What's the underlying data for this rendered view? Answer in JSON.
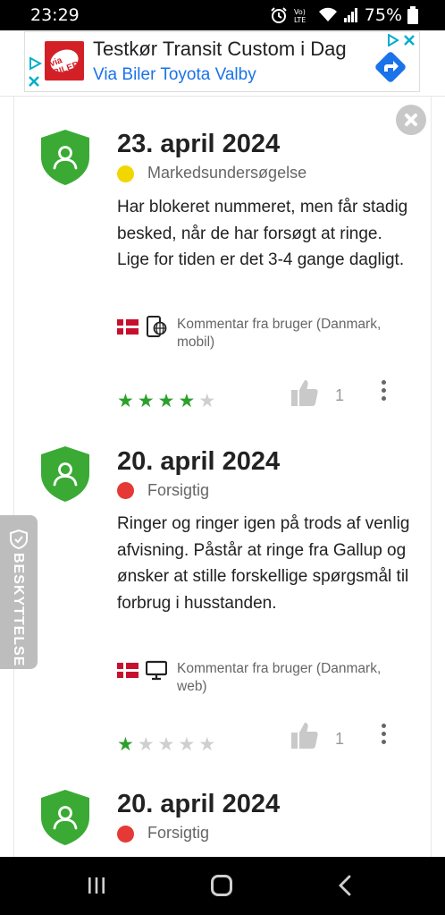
{
  "status_bar": {
    "time": "23:29",
    "network": "Vo) LTE",
    "battery": "75%"
  },
  "ad": {
    "logo_text": "via BILER",
    "title": "Testkør Transit Custom i Dag",
    "subtitle": "Via Biler Toyota Valby"
  },
  "side_tab": {
    "label": "BESKYTTELSE"
  },
  "reviews": [
    {
      "date": "23. april 2024",
      "category": "Markedsundersøgelse",
      "category_color": "#f2d600",
      "text": "Har blokeret nummeret, men får stadig besked, når de har forsøgt at ringe. Lige for tiden er det 3-4 gange dagligt.",
      "device": "mobile-globe-icon",
      "source": "Kommentar fra bruger (Danmark, mobil)",
      "rating": 4,
      "likes": "1"
    },
    {
      "date": "20. april 2024",
      "category": "Forsigtig",
      "category_color": "#e53935",
      "text": "Ringer og ringer igen på trods af venlig afvisning. Påstår at ringe fra Gallup og ønsker at stille forskellige spørgsmål til forbrug i husstanden.",
      "device": "desktop-monitor-icon",
      "source": "Kommentar fra bruger (Danmark, web)",
      "rating": 1,
      "likes": "1"
    },
    {
      "date": "20. april 2024",
      "category": "Forsigtig",
      "category_color": "#e53935"
    }
  ],
  "colors": {
    "shield_green": "#3aaa35",
    "star_green": "#2ca02c",
    "star_grey": "#cfcfcf"
  }
}
